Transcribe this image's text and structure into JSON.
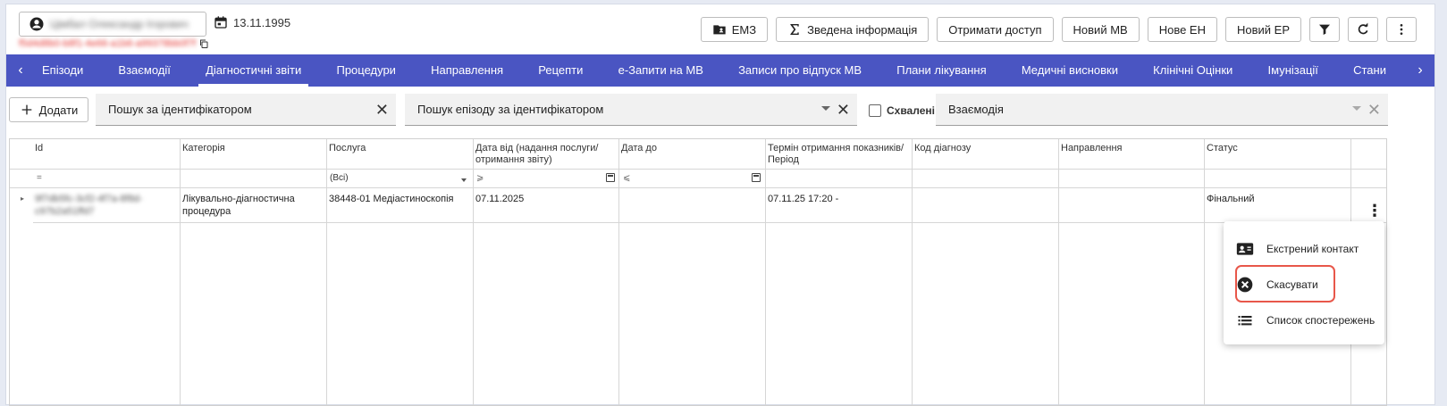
{
  "header": {
    "patient_name": "Цімбал Олександр Ігорович",
    "dob": "13.11.1995",
    "patient_id": "f5d4d8b0-b8f1-4e66-a1b6-a99378bb0f7f",
    "toolbar": [
      {
        "label": "ЕМЗ",
        "icon": "folder-person-icon"
      },
      {
        "label": "Зведена інформація",
        "icon": "sigma-icon"
      },
      {
        "label": "Отримати доступ"
      },
      {
        "label": "Новий МВ"
      },
      {
        "label": "Нове ЕН"
      },
      {
        "label": "Новий ЕР"
      }
    ]
  },
  "nav": {
    "tabs": [
      "Епізоди",
      "Взаємодії",
      "Діагностичні звіти",
      "Процедури",
      "Направлення",
      "Рецепти",
      "е-Запити на МВ",
      "Записи про відпуск МВ",
      "Плани лікування",
      "Медичні висновки",
      "Клінічні Оцінки",
      "Імунізації",
      "Стани"
    ],
    "active_index": 2
  },
  "filters": {
    "add_label": "Додати",
    "id_search": "Пошук за ідентифікатором",
    "episode_search": "Пошук епізоду за ідентифікатором",
    "approved_label": "Схвалені",
    "interaction": "Взаємодія"
  },
  "grid": {
    "columns": [
      "Id",
      "Категорія",
      "Послуга",
      "Дата від (надання послуги/ отримання звіту)",
      "Дата до",
      "Термін отримання показників/ Період",
      "Код діагнозу",
      "Направлення",
      "Статус"
    ],
    "filters": {
      "id_op": "=",
      "service": "(Всі)",
      "date_from_op": "⩾",
      "date_to_op": "⩽"
    },
    "row": {
      "id": "9f7db5fc-3cf2-4f7a-8f8d-c97b2a51ffd7",
      "category": "Лікувально-діагностична процедура",
      "service": "38448-01 Медіастиноскопія",
      "date_from": "07.11.2025",
      "date_to": "",
      "period": "07.11.25 17:20 -",
      "diagnosis": "",
      "referral": "",
      "status": "Фінальний"
    }
  },
  "menu": {
    "items": [
      {
        "label": "Екстрений контакт",
        "icon": "contact-card-icon"
      },
      {
        "label": "Скасувати",
        "icon": "cancel-circle-icon"
      },
      {
        "label": "Список спостережень",
        "icon": "list-icon"
      }
    ]
  },
  "colors": {
    "nav": "#4a55c2",
    "highlight": "#e8574a"
  }
}
